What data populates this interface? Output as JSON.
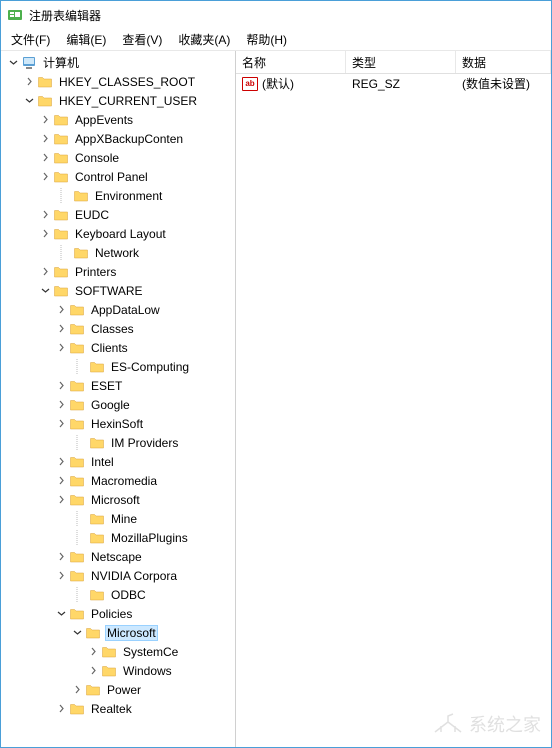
{
  "window": {
    "title": "注册表编辑器"
  },
  "menu": {
    "file": "文件(F)",
    "edit": "编辑(E)",
    "view": "查看(V)",
    "favorites": "收藏夹(A)",
    "help": "帮助(H)"
  },
  "tree": {
    "root": "计算机",
    "hkcr": "HKEY_CLASSES_ROOT",
    "hkcu": "HKEY_CURRENT_USER",
    "hkcu_children": [
      "AppEvents",
      "AppXBackupConten",
      "Console",
      "Control Panel",
      "Environment",
      "EUDC",
      "Keyboard Layout",
      "Network",
      "Printers"
    ],
    "software": "SOFTWARE",
    "software_children": [
      "AppDataLow",
      "Classes",
      "Clients",
      "ES-Computing",
      "ESET",
      "Google",
      "HexinSoft",
      "IM Providers",
      "Intel",
      "Macromedia",
      "Microsoft",
      "Mine",
      "MozillaPlugins",
      "Netscape",
      "NVIDIA Corpora",
      "ODBC"
    ],
    "policies": "Policies",
    "policies_microsoft": "Microsoft",
    "microsoft_children": [
      "SystemCe",
      "Windows"
    ],
    "power": "Power",
    "realtek": "Realtek"
  },
  "list": {
    "headers": {
      "name": "名称",
      "type": "类型",
      "data": "数据"
    },
    "rows": [
      {
        "icon": "ab",
        "name": "(默认)",
        "type": "REG_SZ",
        "data": "(数值未设置)"
      }
    ]
  },
  "watermark": "系统之家"
}
